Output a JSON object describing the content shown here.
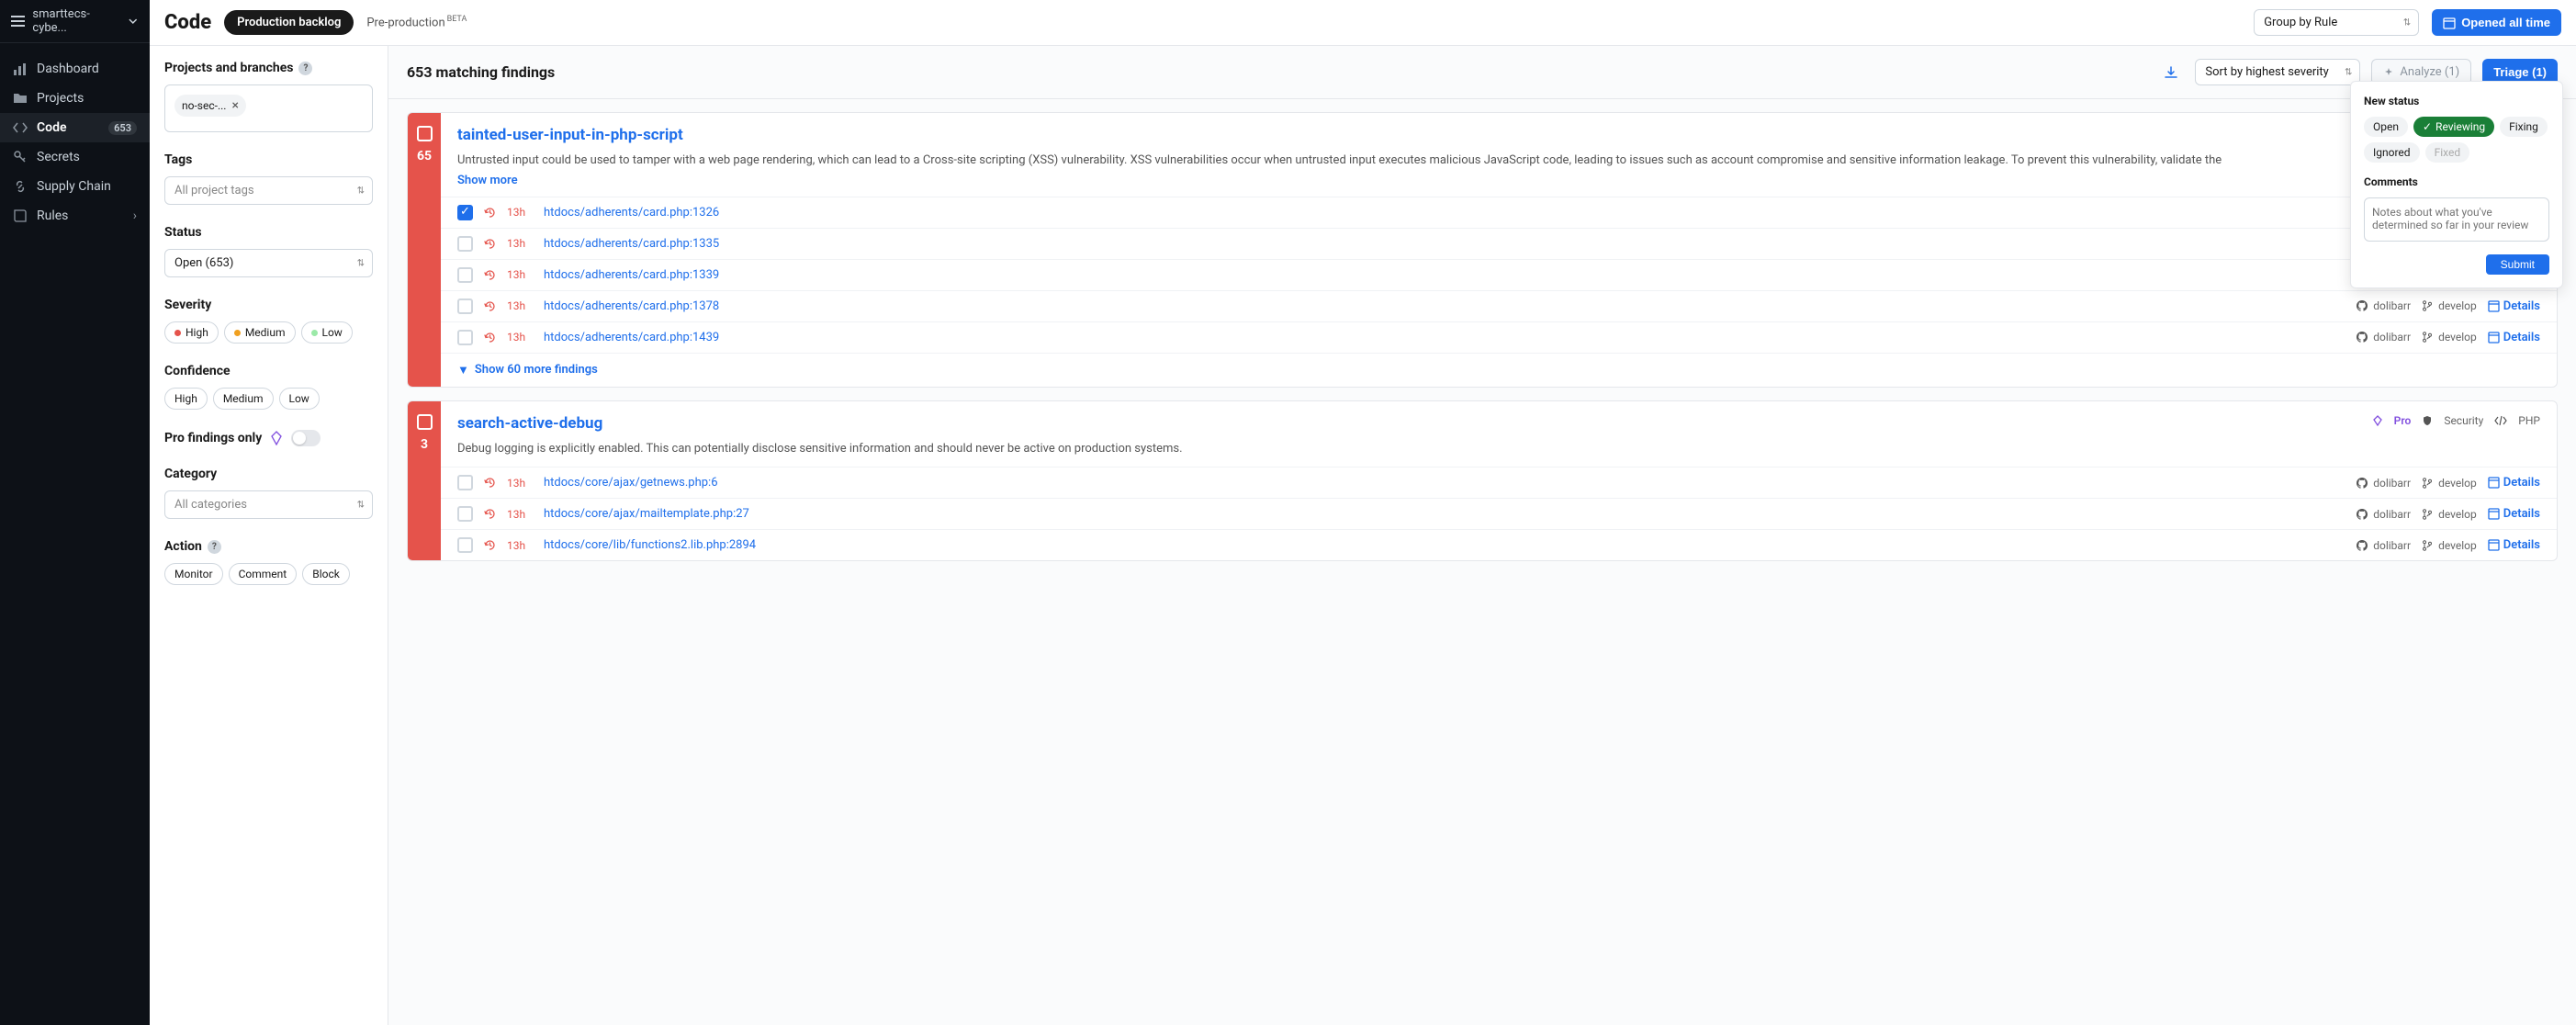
{
  "sidebar": {
    "org": "smarttecs-cybe...",
    "items": [
      {
        "icon": "dashboard",
        "label": "Dashboard"
      },
      {
        "icon": "folder",
        "label": "Projects"
      },
      {
        "icon": "code",
        "label": "Code",
        "badge": "653",
        "active": true
      },
      {
        "icon": "key",
        "label": "Secrets"
      },
      {
        "icon": "link",
        "label": "Supply Chain"
      },
      {
        "icon": "book",
        "label": "Rules",
        "chevron": true
      }
    ]
  },
  "topbar": {
    "title": "Code",
    "tab_active": "Production backlog",
    "tab_inactive": "Pre-production",
    "beta": "BETA",
    "group_by": "Group by Rule",
    "opened_btn": "Opened all time"
  },
  "filters": {
    "projects_label": "Projects and branches",
    "project_chip": "no-sec-...",
    "tags_label": "Tags",
    "tags_placeholder": "All project tags",
    "status_label": "Status",
    "status_value": "Open (653)",
    "severity_label": "Severity",
    "sev": [
      "High",
      "Medium",
      "Low"
    ],
    "confidence_label": "Confidence",
    "conf": [
      "High",
      "Medium",
      "Low"
    ],
    "pro_label": "Pro findings only",
    "category_label": "Category",
    "category_placeholder": "All categories",
    "action_label": "Action",
    "actions": [
      "Monitor",
      "Comment",
      "Block"
    ]
  },
  "findings_header": {
    "count_text": "653 matching findings",
    "sort": "Sort by highest severity",
    "analyze": "Analyze (1)",
    "triage": "Triage (1)"
  },
  "cards": [
    {
      "count": "65",
      "rule": "tainted-user-input-in-php-script",
      "desc": "Untrusted input could be used to tamper with a web page rendering, which can lead to a Cross-site scripting (XSS) vulnerability. XSS vulnerabilities occur when untrusted input executes malicious JavaScript code, leading to issues such as account compromise and sensitive information leakage. To prevent this vulnerability, validate the",
      "show_more": "Show more",
      "rows": [
        {
          "checked": true,
          "time": "13h",
          "path": "htdocs/adherents/card.php:1326"
        },
        {
          "checked": false,
          "time": "13h",
          "path": "htdocs/adherents/card.php:1335"
        },
        {
          "checked": false,
          "time": "13h",
          "path": "htdocs/adherents/card.php:1339"
        },
        {
          "checked": false,
          "time": "13h",
          "path": "htdocs/adherents/card.php:1378",
          "repo": "dolibarr",
          "branch": "develop",
          "details": true
        },
        {
          "checked": false,
          "time": "13h",
          "path": "htdocs/adherents/card.php:1439",
          "repo": "dolibarr",
          "branch": "develop",
          "details": true
        }
      ],
      "more": "Show 60 more findings"
    },
    {
      "count": "3",
      "rule": "search-active-debug",
      "desc": "Debug logging is explicitly enabled. This can potentially disclose sensitive information and should never be active on production systems.",
      "tags": {
        "pro": "Pro",
        "security": "Security",
        "lang": "PHP"
      },
      "rows": [
        {
          "checked": false,
          "time": "13h",
          "path": "htdocs/core/ajax/getnews.php:6",
          "repo": "dolibarr",
          "branch": "develop",
          "details": true
        },
        {
          "checked": false,
          "time": "13h",
          "path": "htdocs/core/ajax/mailtemplate.php:27",
          "repo": "dolibarr",
          "branch": "develop",
          "details": true
        },
        {
          "checked": false,
          "time": "13h",
          "path": "htdocs/core/lib/functions2.lib.php:2894",
          "repo": "dolibarr",
          "branch": "develop",
          "details": true
        }
      ]
    }
  ],
  "triage_panel": {
    "new_status": "New status",
    "statuses": [
      "Open",
      "Reviewing",
      "Fixing",
      "Ignored",
      "Fixed"
    ],
    "active_status": "Reviewing",
    "disabled_status": "Fixed",
    "comments_label": "Comments",
    "comments_placeholder": "Notes about what you've determined so far in your review",
    "submit": "Submit"
  },
  "labels": {
    "details": "Details"
  }
}
